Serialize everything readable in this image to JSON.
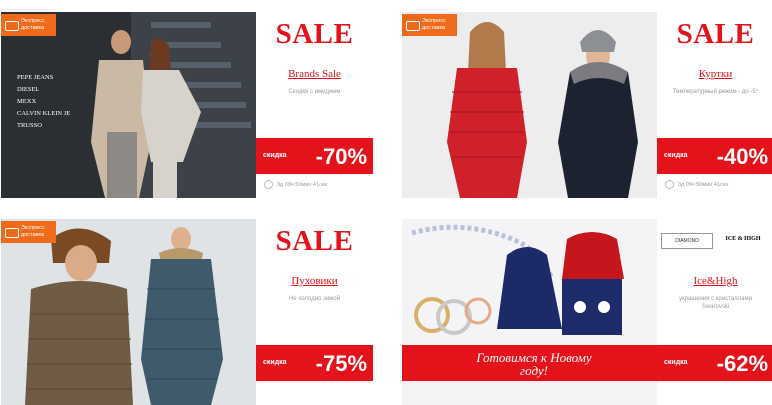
{
  "cards": [
    {
      "express": "Экспресс доставка",
      "sale": "SALE",
      "title": "Brands Sale",
      "subtitle": "Скидки с имиджем",
      "discount_label": "скидка",
      "discount": "-70%",
      "timer": "3д 09ч 50мин 41сек",
      "brands": [
        "PEPE JEANS",
        "DIESEL",
        "MEXX",
        "CALVIN KLEIN JE",
        "TRUSSO"
      ]
    },
    {
      "express": "Экспресс доставка",
      "sale": "SALE",
      "title": "Куртки",
      "subtitle": "Температурный режим - до -5°",
      "discount_label": "скидка",
      "discount": "-40%",
      "timer": "3д 09ч 50мин 41сек"
    },
    {
      "express": "Экспресс доставка",
      "sale": "SALE",
      "title": "Пуховики",
      "subtitle": "Не холодно зимой",
      "discount_label": "скидка",
      "discount": "-75%"
    },
    {
      "brand_logos": [
        "DIAMOND",
        "ICE & HIGH"
      ],
      "title": "Ice&High",
      "subtitle": "украшения с кристаллами Swarovski",
      "promo": "Готовимся к Новому году!",
      "discount_label": "скидка",
      "discount": "-62%"
    }
  ],
  "colors": {
    "accent": "#e3121b",
    "express": "#f06a1b"
  }
}
